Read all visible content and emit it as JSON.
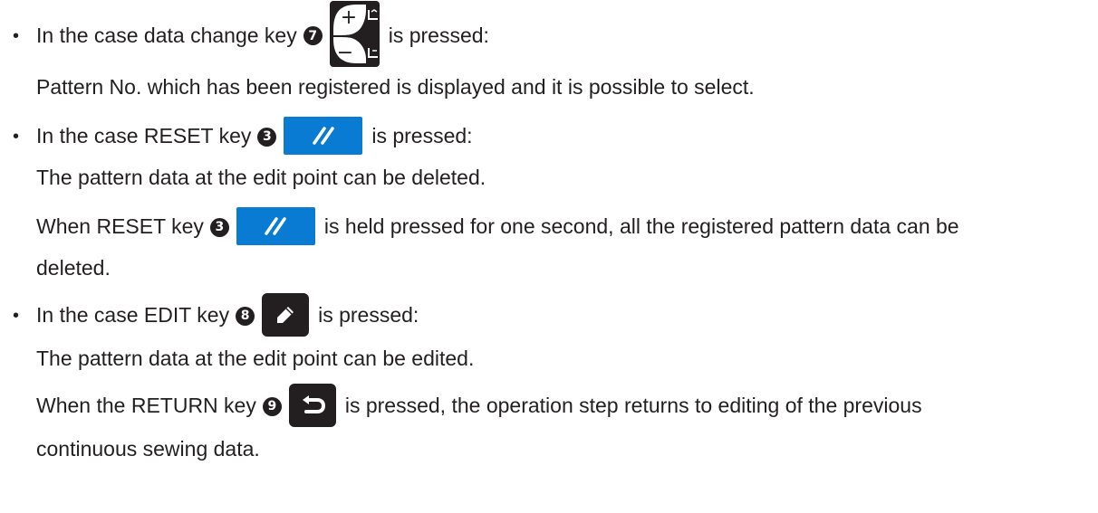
{
  "bullets": {
    "b1": "•",
    "b2": "•",
    "b3": "•"
  },
  "lines": {
    "l1_pre": "In the case data change key",
    "l1_num": "❼",
    "l1_post": "is pressed:",
    "l2": "Pattern No. which has been registered is displayed and it is possible to select.",
    "l3_pre": "In the case RESET key",
    "l3_num": "❸",
    "l3_post": "is pressed:",
    "l4": "The pattern data at the edit point can be deleted.",
    "l5_pre": "When RESET key",
    "l5_num": "❸",
    "l5_post": "is held pressed for one second, all the registered pattern data can be",
    "l6": "deleted.",
    "l7_pre": "In the case EDIT key",
    "l7_num": "❽",
    "l7_post": "is pressed:",
    "l8": "The pattern data at the edit point can be edited.",
    "l9_pre": "When the RETURN key",
    "l9_num": "❾",
    "l9_post": "is pressed, the operation step returns to editing of the previous",
    "l10": "continuous sewing data."
  },
  "keys": {
    "data_change": {
      "icon": "plus-minus-pitch-icon",
      "plus": "+",
      "minus": "−"
    },
    "reset": {
      "icon": "reset-slash-icon"
    },
    "edit": {
      "icon": "pencil-icon"
    },
    "return": {
      "icon": "return-arrow-icon"
    }
  },
  "colors": {
    "text": "#231f20",
    "reset_key": "#0a7bd3",
    "dark_key": "#231f20"
  }
}
